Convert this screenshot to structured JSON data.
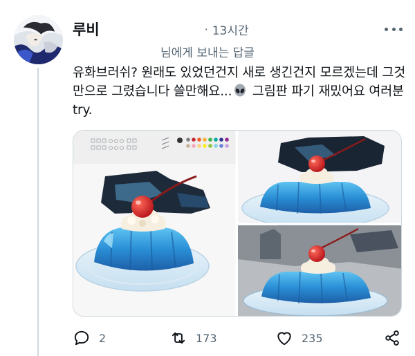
{
  "tweet": {
    "author": "루비",
    "separator": "·",
    "time": "13시간",
    "reply_to": "님에게 보내는 답글",
    "text_part1": "유화브러쉬? 원래도 있었던건지 새로 생긴건지 모르겠는데 그것만으로 그렸습니다 쓸만해요...",
    "text_part2": " 그림판 파기 재밌어요 여러분 try."
  },
  "icons": {
    "more": "more-dots-icon",
    "reply": "reply-bubble-icon",
    "retweet": "retweet-icon",
    "like": "heart-icon",
    "share": "share-icon",
    "emoji": "alien-emoji-icon"
  },
  "actions": {
    "reply_count": "2",
    "retweet_count": "173",
    "like_count": "235"
  },
  "colors": {
    "text": "#0f1419",
    "secondary": "#536471",
    "border": "#cfd9de",
    "jelly": "#2f8fd8"
  }
}
